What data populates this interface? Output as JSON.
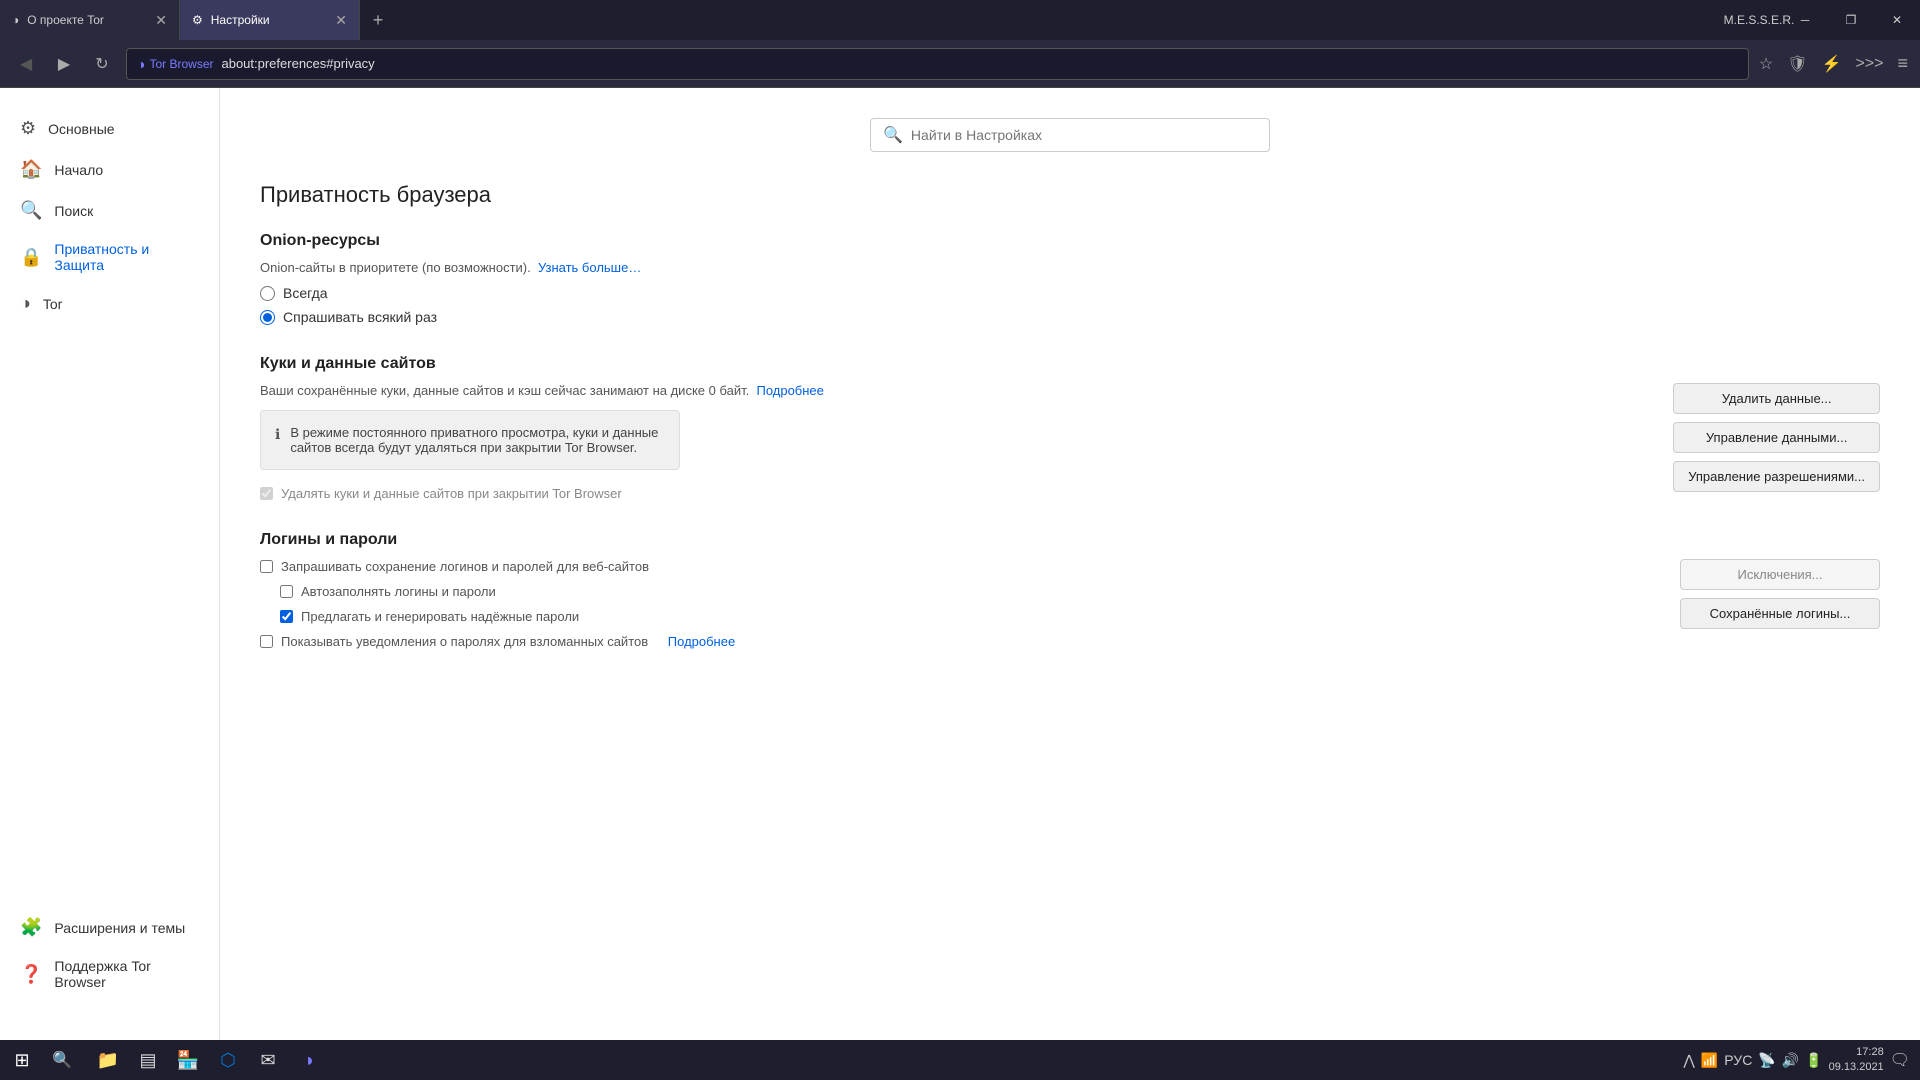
{
  "window": {
    "title_inactive": "О проекте Tor",
    "title_active": "Настройки",
    "messer": "M.E.S.S.E.R."
  },
  "tabs": [
    {
      "id": "tab1",
      "label": "О проекте Tor",
      "active": false
    },
    {
      "id": "tab2",
      "label": "Настройки",
      "active": true
    }
  ],
  "addressbar": {
    "site_label": "Tor Browser",
    "url": "about:preferences#privacy",
    "back_title": "Назад",
    "forward_title": "Вперёд",
    "reload_title": "Обновить"
  },
  "search": {
    "placeholder": "Найти в Настройках"
  },
  "page": {
    "title": "Приватность браузера"
  },
  "sidebar": {
    "items": [
      {
        "id": "osnov",
        "label": "Основные",
        "icon": "⚙"
      },
      {
        "id": "nachalo",
        "label": "Начало",
        "icon": "🏠"
      },
      {
        "id": "poisk",
        "label": "Поиск",
        "icon": "🔍"
      },
      {
        "id": "privacy",
        "label": "Приватность и Защита",
        "icon": "🔒",
        "active": true
      },
      {
        "id": "tor",
        "label": "Tor",
        "icon": "◑"
      }
    ],
    "bottom_items": [
      {
        "id": "ext",
        "label": "Расширения и темы",
        "icon": "🧩"
      },
      {
        "id": "support",
        "label": "Поддержка Tor Browser",
        "icon": "❓"
      }
    ]
  },
  "sections": {
    "onion": {
      "title": "Onion-ресурсы",
      "desc": "Onion-сайты в приоритете (по возможности).",
      "link": "Узнать больше…",
      "options": [
        {
          "id": "always",
          "label": "Всегда",
          "checked": false
        },
        {
          "id": "ask",
          "label": "Спрашивать всякий раз",
          "checked": true
        }
      ]
    },
    "cookies": {
      "title": "Куки и данные сайтов",
      "desc": "Ваши сохранённые куки, данные сайтов и кэш сейчас занимают на диске 0 байт.",
      "link": "Подробнее",
      "info_text": "В режиме постоянного приватного просмотра, куки и данные сайтов всегда будут удаляться при закрытии Tor Browser.",
      "buttons": [
        {
          "id": "delete_data",
          "label": "Удалить данные..."
        },
        {
          "id": "manage_data",
          "label": "Управление данными..."
        },
        {
          "id": "manage_perms",
          "label": "Управление разрешениями..."
        }
      ],
      "checkbox_label": "Удалять куки и данные сайтов при закрытии Tor Browser",
      "checkbox_checked": true
    },
    "logins": {
      "title": "Логины и пароли",
      "checkboxes": [
        {
          "id": "ask_save",
          "label": "Запрашивать сохранение логинов и паролей для веб-сайтов",
          "checked": false
        },
        {
          "id": "autofill",
          "label": "Автозаполнять логины и пароли",
          "checked": false
        },
        {
          "id": "suggest_pw",
          "label": "Предлагать и генерировать надёжные пароли",
          "checked": true
        },
        {
          "id": "show_notif",
          "label": "Показывать уведомления о паролях для взломанных сайтов",
          "checked": false
        }
      ],
      "buttons": [
        {
          "id": "exceptions",
          "label": "Исключения..."
        },
        {
          "id": "saved_logins",
          "label": "Сохранённые логины..."
        }
      ],
      "link": "Подробнее"
    }
  },
  "taskbar": {
    "time": "17:28",
    "date": "09.13.2021",
    "lang": "РУС"
  }
}
